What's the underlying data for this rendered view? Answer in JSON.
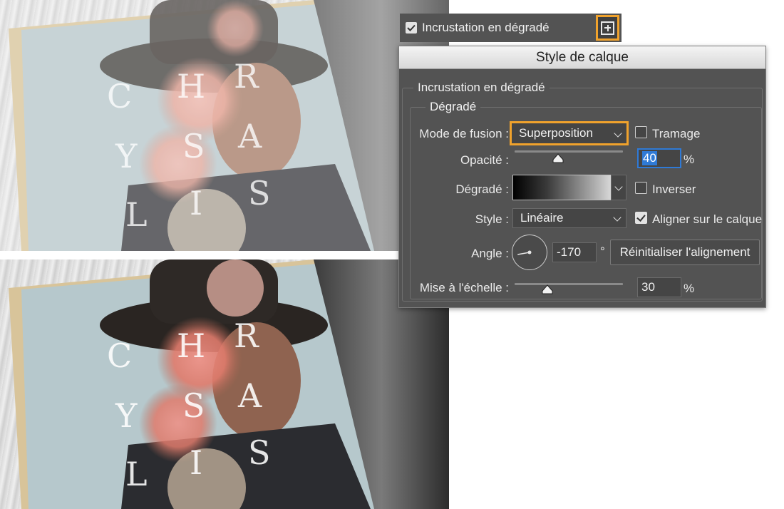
{
  "layer_row": {
    "checked": true,
    "label": "Incrustation en dégradé",
    "add_icon": "plus-square-icon"
  },
  "dialog": {
    "title": "Style de calque",
    "section_title": "Incrustation en dégradé",
    "subsection_title": "Dégradé",
    "blend_mode": {
      "label": "Mode de fusion :",
      "value": "Superposition"
    },
    "dither": {
      "label": "Tramage",
      "checked": false
    },
    "opacity": {
      "label": "Opacité :",
      "value": "40",
      "unit": "%",
      "fraction": 0.4
    },
    "gradient": {
      "label": "Dégradé :",
      "from_color": "#000000",
      "to_color": "#ffffff"
    },
    "reverse": {
      "label": "Inverser",
      "checked": false
    },
    "style": {
      "label": "Style :",
      "value": "Linéaire"
    },
    "align_with_layer": {
      "label": "Aligner sur le calque",
      "checked": true
    },
    "angle": {
      "label": "Angle :",
      "value": "-170",
      "unit": "°",
      "degrees": -170
    },
    "reset_alignment_button": "Réinitialiser l'alignement",
    "scale": {
      "label": "Mise à l'échelle :",
      "value": "30",
      "unit": "%",
      "fraction": 0.3
    }
  },
  "magazine_letters": [
    "C",
    "H",
    "R",
    "Y",
    "S",
    "A",
    "L",
    "I",
    "S"
  ],
  "colors": {
    "accent_highlight": "#f0a22c",
    "panel_bg": "#535353",
    "focus_blue": "#2f7ad6"
  }
}
